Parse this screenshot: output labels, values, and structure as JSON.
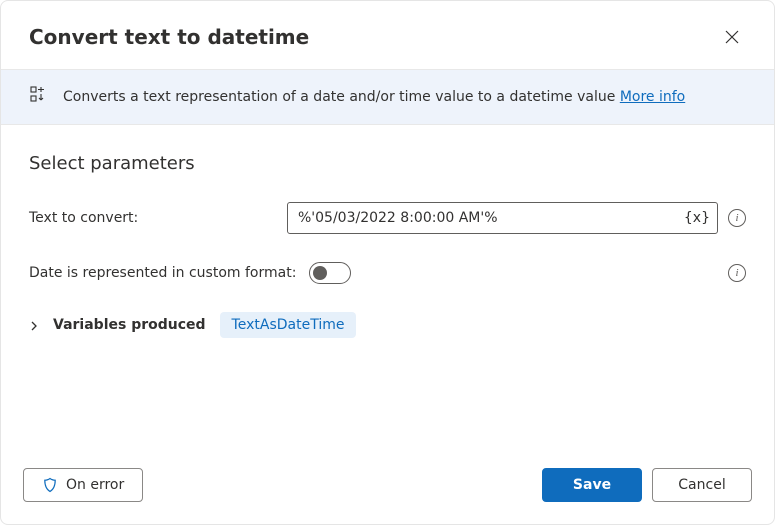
{
  "header": {
    "title": "Convert text to datetime"
  },
  "banner": {
    "description": "Converts a text representation of a date and/or time value to a datetime value ",
    "more_info": "More info"
  },
  "section": {
    "title": "Select parameters"
  },
  "fields": {
    "text_to_convert": {
      "label": "Text to convert:",
      "value": "%'05/03/2022 8:00:00 AM'%",
      "var_icon": "{x}"
    },
    "custom_format": {
      "label": "Date is represented in custom format:",
      "value": false
    }
  },
  "variables": {
    "label": "Variables produced",
    "produced": "TextAsDateTime"
  },
  "footer": {
    "on_error": "On error",
    "save": "Save",
    "cancel": "Cancel"
  }
}
